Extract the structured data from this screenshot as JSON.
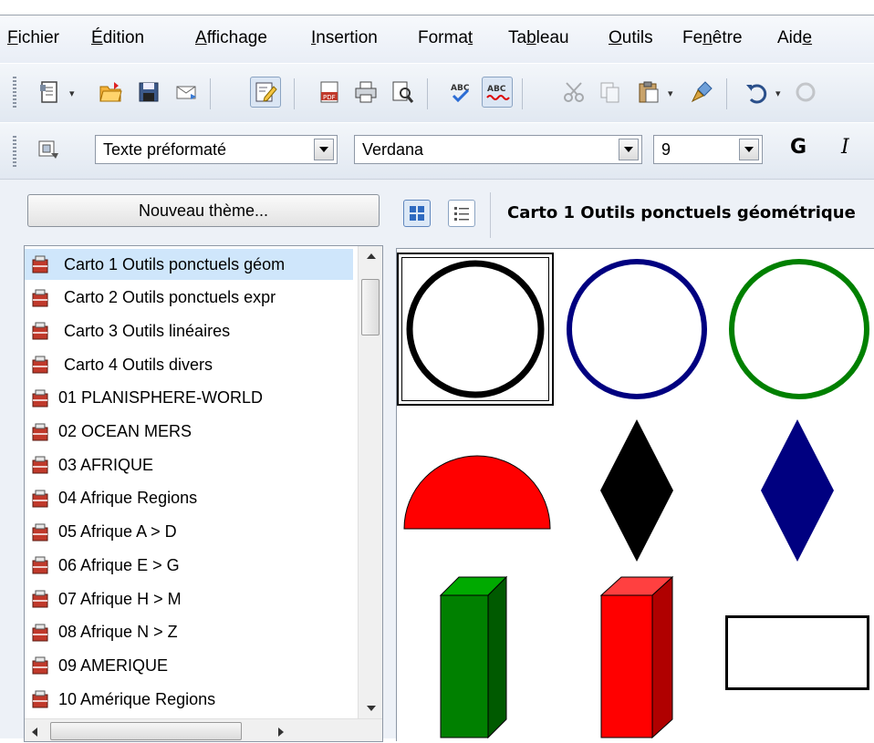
{
  "menu": {
    "items": [
      {
        "label": "Fichier"
      },
      {
        "label": "Édition"
      },
      {
        "label": "Affichage"
      },
      {
        "label": "Insertion"
      },
      {
        "label": "Format"
      },
      {
        "label": "Tableau"
      },
      {
        "label": "Outils"
      },
      {
        "label": "Fenêtre"
      },
      {
        "label": "Aide"
      }
    ]
  },
  "format_bar": {
    "paragraph_style": "Texte préformaté",
    "font_name": "Verdana",
    "font_size": "9",
    "bold_label": "G",
    "italic_label": "I"
  },
  "gallery": {
    "new_theme_label": "Nouveau thème...",
    "current_theme_title": "Carto 1 Outils ponctuels géométrique",
    "themes": [
      {
        "label": "Carto 1 Outils ponctuels géom"
      },
      {
        "label": "Carto 2 Outils ponctuels expr"
      },
      {
        "label": "Carto 3 Outils  linéaires"
      },
      {
        "label": "Carto 4 Outils divers"
      },
      {
        "label": "01 PLANISPHERE-WORLD"
      },
      {
        "label": "02 OCEAN MERS"
      },
      {
        "label": "03 AFRIQUE"
      },
      {
        "label": "04 Afrique Regions"
      },
      {
        "label": "05 Afrique A > D"
      },
      {
        "label": "06 Afrique E > G"
      },
      {
        "label": "07 Afrique H > M"
      },
      {
        "label": "08 Afrique N > Z"
      },
      {
        "label": "09 AMERIQUE"
      },
      {
        "label": "10 Amérique Regions"
      }
    ],
    "selected_index": 0,
    "shape_colors": {
      "black": "#000000",
      "navy": "#000080",
      "green": "#008000",
      "red": "#ff0000"
    }
  }
}
